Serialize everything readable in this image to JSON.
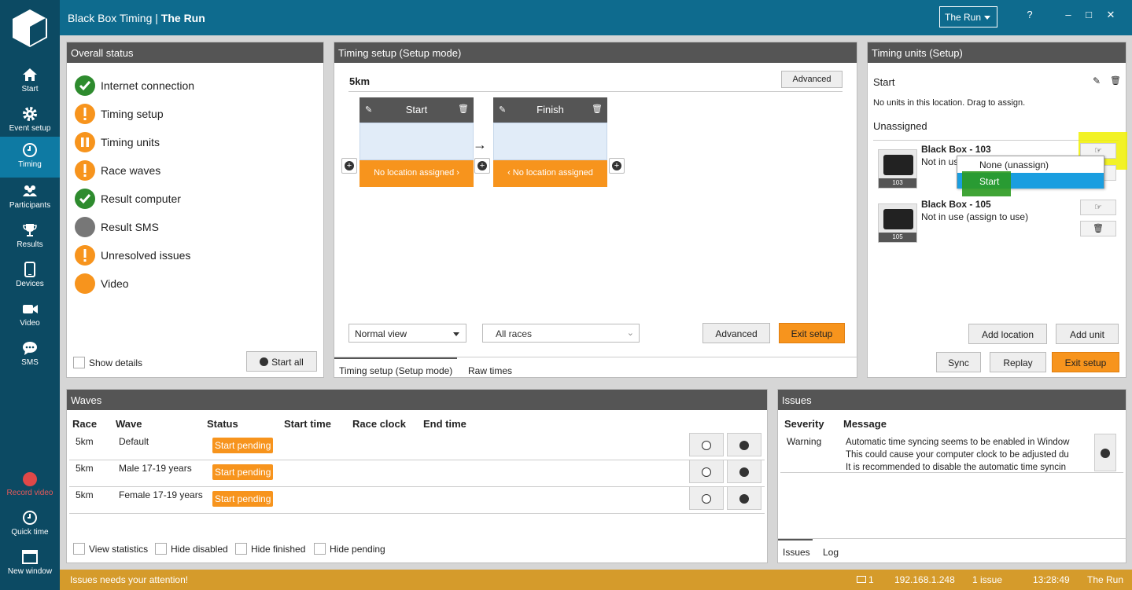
{
  "app": {
    "title_prefix": "Black Box Timing | ",
    "title_event": "The Run",
    "event_select": "The Run"
  },
  "window": {
    "help": "?",
    "minimize": "–",
    "maximize": "□",
    "close": "✕"
  },
  "sidebar": {
    "items": [
      {
        "label": "Start",
        "icon": "home-icon"
      },
      {
        "label": "Event setup",
        "icon": "gear-icon"
      },
      {
        "label": "Timing",
        "icon": "clock-icon"
      },
      {
        "label": "Participants",
        "icon": "people-icon"
      },
      {
        "label": "Results",
        "icon": "trophy-icon"
      },
      {
        "label": "Devices",
        "icon": "tablet-icon"
      },
      {
        "label": "Video",
        "icon": "video-icon"
      },
      {
        "label": "SMS",
        "icon": "chat-icon"
      }
    ],
    "record_video": "Record video",
    "quick_time": "Quick time",
    "new_window": "New window"
  },
  "overall": {
    "title": "Overall status",
    "items": [
      {
        "label": "Internet connection",
        "state": "ok"
      },
      {
        "label": "Timing setup",
        "state": "warning"
      },
      {
        "label": "Timing units",
        "state": "paused"
      },
      {
        "label": "Race waves",
        "state": "warning"
      },
      {
        "label": "Result computer",
        "state": "ok"
      },
      {
        "label": "Result SMS",
        "state": "off"
      },
      {
        "label": "Unresolved issues",
        "state": "warning"
      },
      {
        "label": "Video",
        "state": "pending"
      }
    ],
    "show_details": "Show details",
    "start_all": "Start all"
  },
  "timing": {
    "title": "Timing setup (Setup mode)",
    "race": "5km",
    "advanced_top": "Advanced",
    "locations": [
      {
        "name": "Start",
        "status": "No location assigned"
      },
      {
        "name": "Finish",
        "status": "No location assigned"
      }
    ],
    "view_select": "Normal view",
    "race_select": "All races",
    "advanced": "Advanced",
    "exit_setup": "Exit setup",
    "tabs": [
      "Timing setup (Setup mode)",
      "Raw times"
    ]
  },
  "units": {
    "title": "Timing units (Setup)",
    "location": "Start",
    "no_units": "No units in this location. Drag to assign.",
    "unassigned": "Unassigned",
    "list": [
      {
        "name": "Black Box - 103",
        "status": "Not in us",
        "num": "103"
      },
      {
        "name": "Black Box - 105",
        "status": "Not in use (assign to use)",
        "num": "105"
      }
    ],
    "dropdown": [
      "None (unassign)",
      "Start"
    ],
    "add_location": "Add location",
    "add_unit": "Add unit",
    "sync": "Sync",
    "replay": "Replay",
    "exit_setup": "Exit setup"
  },
  "waves": {
    "title": "Waves",
    "columns": [
      "Race",
      "Wave",
      "Status",
      "Start time",
      "Race clock",
      "End time"
    ],
    "rows": [
      {
        "race": "5km",
        "wave": "Default",
        "status": "Start pending"
      },
      {
        "race": "5km",
        "wave": "Male 17-19 years",
        "status": "Start pending"
      },
      {
        "race": "5km",
        "wave": "Female 17-19 years",
        "status": "Start pending"
      }
    ],
    "filters": [
      "View statistics",
      "Hide disabled",
      "Hide finished",
      "Hide pending"
    ]
  },
  "issues": {
    "title": "Issues",
    "columns": [
      "Severity",
      "Message"
    ],
    "rows": [
      {
        "severity": "Warning",
        "lines": [
          "Automatic time syncing seems to be enabled in Window",
          "This could cause your computer clock to be adjusted du",
          "It is recommended to disable the automatic time syncin"
        ]
      }
    ],
    "tabs": [
      "Issues",
      "Log"
    ]
  },
  "footer": {
    "message": "Issues needs your attention!",
    "units": "1",
    "ip": "192.168.1.248",
    "issues": "1 issue",
    "time": "13:28:49",
    "event": "The Run"
  },
  "colors": {
    "sidebar": "#0c4a63",
    "titlebar": "#0e6b8e",
    "accent": "#f7941d",
    "ok": "#2e8b2e",
    "footer": "#d59b2b"
  }
}
